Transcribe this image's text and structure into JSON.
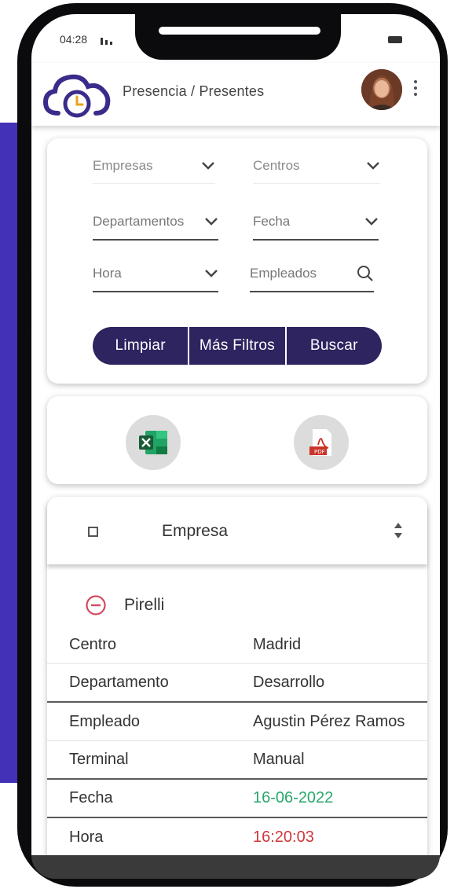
{
  "status_bar": {
    "time": "04:28"
  },
  "header": {
    "breadcrumb": "Presencia / Presentes"
  },
  "filters": {
    "empresas": "Empresas",
    "centros": "Centros",
    "departamentos": "Departamentos",
    "fecha": "Fecha",
    "hora": "Hora",
    "empleados": "Empleados"
  },
  "actions": {
    "limpiar": "Limpiar",
    "mas_filtros": "Más Filtros",
    "buscar": "Buscar"
  },
  "exports": {
    "excel_icon": "excel-icon",
    "pdf_icon": "pdf-icon"
  },
  "table": {
    "column": "Empresa",
    "group": "Pirelli",
    "rows": [
      {
        "label": "Centro",
        "value": "Madrid"
      },
      {
        "label": "Departamento",
        "value": "Desarrollo"
      },
      {
        "label": "Empleado",
        "value": "Agustin Pérez Ramos"
      },
      {
        "label": "Terminal",
        "value": "Manual"
      },
      {
        "label": "Fecha",
        "value": "16-06-2022"
      },
      {
        "label": "Hora",
        "value": "16:20:03"
      }
    ]
  },
  "colors": {
    "brand": "#2d2460",
    "accent_band": "#4331b8",
    "date_value": "#27a86a",
    "time_value": "#d0363a",
    "collapse_icon": "#d44a5e"
  }
}
